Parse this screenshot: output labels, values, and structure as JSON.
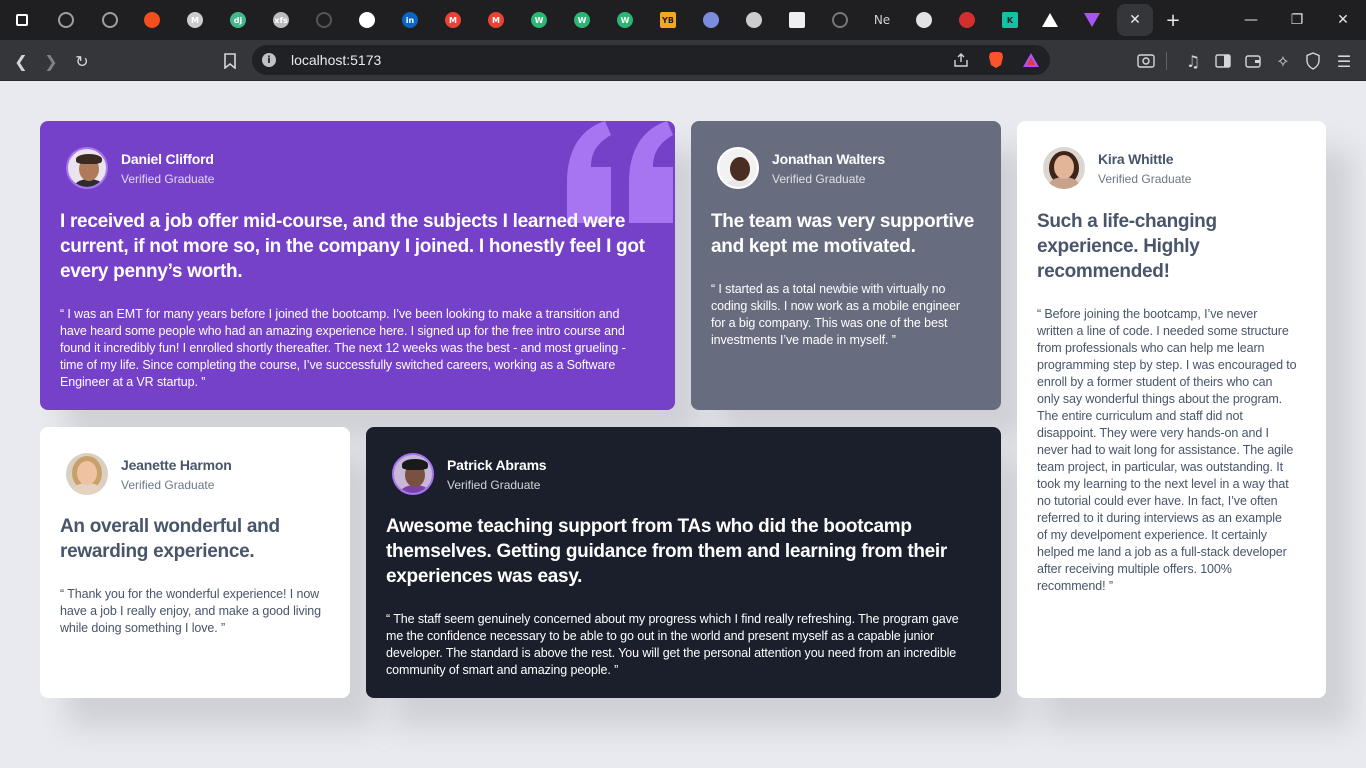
{
  "browser": {
    "tabs": [
      {
        "icon": "square-icon",
        "label": "",
        "color": "#ffffff"
      },
      {
        "icon": "ring-icon",
        "label": "",
        "color": "#9aa0a6"
      },
      {
        "icon": "ring-icon",
        "label": "",
        "color": "#9aa0a6"
      },
      {
        "icon": "figma-icon",
        "label": "",
        "color": "#f24e1e"
      },
      {
        "icon": "medium-icon",
        "label": "M",
        "color": "#cccccc"
      },
      {
        "icon": "django-icon",
        "label": "dj",
        "color": "#44b78b"
      },
      {
        "icon": "xfs-icon",
        "label": "xfs",
        "color": "#bbbbbb"
      },
      {
        "icon": "circle-icon",
        "label": "",
        "color": "#555555"
      },
      {
        "icon": "white-circle-icon",
        "label": "",
        "color": "#ffffff"
      },
      {
        "icon": "linkedin-icon",
        "label": "in",
        "color": "#0a66c2"
      },
      {
        "icon": "gmail-icon",
        "label": "M",
        "color": "#ea4335"
      },
      {
        "icon": "gmail-icon",
        "label": "M",
        "color": "#ea4335"
      },
      {
        "icon": "w-icon",
        "label": "W",
        "color": "#2bb673"
      },
      {
        "icon": "w-icon",
        "label": "W",
        "color": "#2bb673"
      },
      {
        "icon": "w-icon",
        "label": "W",
        "color": "#2bb673"
      },
      {
        "icon": "yb-icon",
        "label": "YB",
        "color": "#f5a623"
      },
      {
        "icon": "globe-icon",
        "label": "",
        "color": "#7b8cde"
      },
      {
        "icon": "owl-icon",
        "label": "",
        "color": "#cccccc"
      },
      {
        "icon": "page-icon",
        "label": "",
        "color": "#eeeeee"
      },
      {
        "icon": "loading-icon",
        "label": "",
        "color": "#777777"
      },
      {
        "icon": "text-tab",
        "label": "Ne",
        "color": "#cfd1d6"
      },
      {
        "icon": "openai-icon",
        "label": "",
        "color": "#e3e3e3"
      },
      {
        "icon": "santa-icon",
        "label": "",
        "color": "#d32f2f"
      },
      {
        "icon": "k-icon",
        "label": "K",
        "color": "#13c2a3"
      },
      {
        "icon": "triangle-icon",
        "label": "",
        "color": "#ffffff"
      },
      {
        "icon": "vite-icon",
        "label": "",
        "color": "#a855f7"
      }
    ],
    "url": "localhost:5173"
  },
  "testimonials": [
    {
      "name": "Daniel Clifford",
      "role": "Verified Graduate",
      "headline_lines": [
        "I received a job offer mid-course, and the subjects I learned were",
        "current, if not more so, in the company I joined. I honestly feel I got",
        "every penny’s worth."
      ],
      "quote_lines": [
        "“ I was an EMT for many years before I joined the bootcamp. I’ve been looking to make a transition and",
        "have heard some people who had an amazing experience here. I signed up for the free intro course and",
        "found it incredibly fun! I enrolled shortly thereafter. The next 12 weeks was the best - and most grueling -",
        "time of my life. Since completing the course, I’ve successfully switched careers, working as a Software",
        "Engineer at a VR startup. ”"
      ]
    },
    {
      "name": "Jonathan Walters",
      "role": "Verified Graduate",
      "headline_lines": [
        "The team was very supportive",
        "and kept me motivated."
      ],
      "quote_lines": [
        "“ I started as a total newbie with virtually no",
        "coding skills. I now work as a mobile engineer",
        "for a big company. This was one of the best",
        "investments I’ve made in myself. ”"
      ]
    },
    {
      "name": "Kira Whittle",
      "role": "Verified Graduate",
      "headline_lines": [
        "Such a life-changing",
        "experience. Highly",
        "recommended!"
      ],
      "quote_lines": [
        "“ Before joining the bootcamp, I’ve never",
        "written a line of code. I needed some structure",
        "from professionals who can help me learn",
        "programming step by step. I was encouraged to",
        "enroll by a former student of theirs who can",
        "only say wonderful things about the program.",
        "The entire curriculum and staff did not",
        "disappoint. They were very hands-on and I",
        "never had to wait long for assistance. The agile",
        "team project, in particular, was outstanding. It",
        "took my learning to the next level in a way that",
        "no tutorial could ever have. In fact, I’ve often",
        "referred to it during interviews as an example",
        "of my develpoment experience. It certainly",
        "helped me land a job as a full-stack developer",
        "after receiving multiple offers. 100%",
        "recommend! ”"
      ]
    },
    {
      "name": "Jeanette Harmon",
      "role": "Verified Graduate",
      "headline_lines": [
        "An overall wonderful and",
        "rewarding experience."
      ],
      "quote_lines": [
        "“ Thank you for the wonderful experience! I now",
        "have a job I really enjoy, and make a good living",
        "while doing something I love. ”"
      ]
    },
    {
      "name": "Patrick Abrams",
      "role": "Verified Graduate",
      "headline_lines": [
        "Awesome teaching support from TAs who did the bootcamp",
        "themselves. Getting guidance from them and learning from their",
        "experiences was easy."
      ],
      "quote_lines": [
        "“ The staff seem genuinely concerned about my progress which I find really refreshing. The program gave",
        "me the confidence necessary to be able to go out in the world and present myself as a capable junior",
        "developer. The standard is above the rest. You will get the personal attention you need from an incredible",
        "community of smart and amazing people. ”"
      ]
    }
  ],
  "colors": {
    "page_bg": "#e8eaef",
    "violet": "#7541c8",
    "grayish_blue": "#676d7f",
    "blackish_blue": "#1b1f2b",
    "white": "#ffffff",
    "dark_text": "#48556a",
    "quote_mark": "#a775f1"
  }
}
